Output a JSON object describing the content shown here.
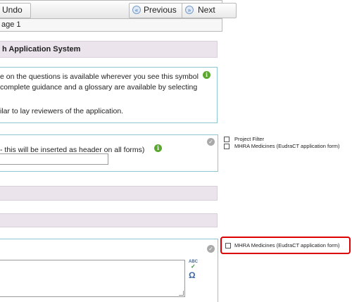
{
  "toolbar": {
    "undo_label": "Undo",
    "previous_label": "Previous",
    "next_label": "Next"
  },
  "page_indicator": "age 1",
  "form_title": "h Application System",
  "guidance": {
    "line1": "e on the questions is available wherever you see this symbol",
    "line2": "complete guidance and a glossary are available by selecting",
    "line3": "ilar to lay reviewers of the application."
  },
  "short_title_question": "- this will be inserted as header on all forms)",
  "form_filter": {
    "items": [
      {
        "label": "Project Filter"
      },
      {
        "label": "MHRA Medicines (EudraCT application form)"
      }
    ]
  },
  "highlighted_filter": {
    "label": "MHRA Medicines (EudraCT application form)"
  },
  "text_tools": {
    "spellcheck_label": "ABC",
    "special_char_label": "Ω"
  },
  "colors": {
    "highlight_border": "#dd0000",
    "section_band": "#ebe4ec",
    "box_border": "#8ec7cf",
    "info_icon": "#5aa82e"
  }
}
